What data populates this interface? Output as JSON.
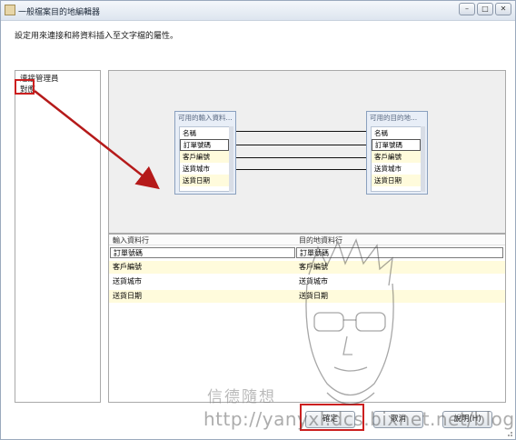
{
  "window": {
    "title": "一般檔案目的地編輯器",
    "controls": [
      "–",
      "□",
      "✕"
    ]
  },
  "description": "設定用來連接和將資料插入至文字檔的屬性。",
  "sidebar": {
    "items": [
      {
        "label": "連接管理員"
      },
      {
        "label": "對應"
      }
    ]
  },
  "diagram": {
    "input_box": {
      "title": "可用的輸入資料...",
      "header": "名稱",
      "columns": [
        "訂單號碼",
        "客戶編號",
        "送貨城市",
        "送貨日期"
      ]
    },
    "output_box": {
      "title": "可用的目的地...",
      "header": "名稱",
      "columns": [
        "訂單號碼",
        "客戶編號",
        "送貨城市",
        "送貨日期"
      ]
    }
  },
  "mapping_grid": {
    "headers": [
      "輸入資料行",
      "目的地資料行"
    ],
    "rows": [
      {
        "input": "訂單號碼",
        "dest": "訂單號碼"
      },
      {
        "input": "客戶編號",
        "dest": "客戶編號"
      },
      {
        "input": "送貨城市",
        "dest": "送貨城市"
      },
      {
        "input": "送貨日期",
        "dest": "送貨日期"
      }
    ]
  },
  "buttons": {
    "ok": "確定",
    "cancel": "取消",
    "help": "說明(H)"
  },
  "watermark": {
    "name": "信德隨想",
    "url": "http://yanyxl.dcs.bixnet.net/blog"
  },
  "colors": {
    "highlight": "#cc1f1f",
    "row_yellow": "#fffbdc"
  }
}
